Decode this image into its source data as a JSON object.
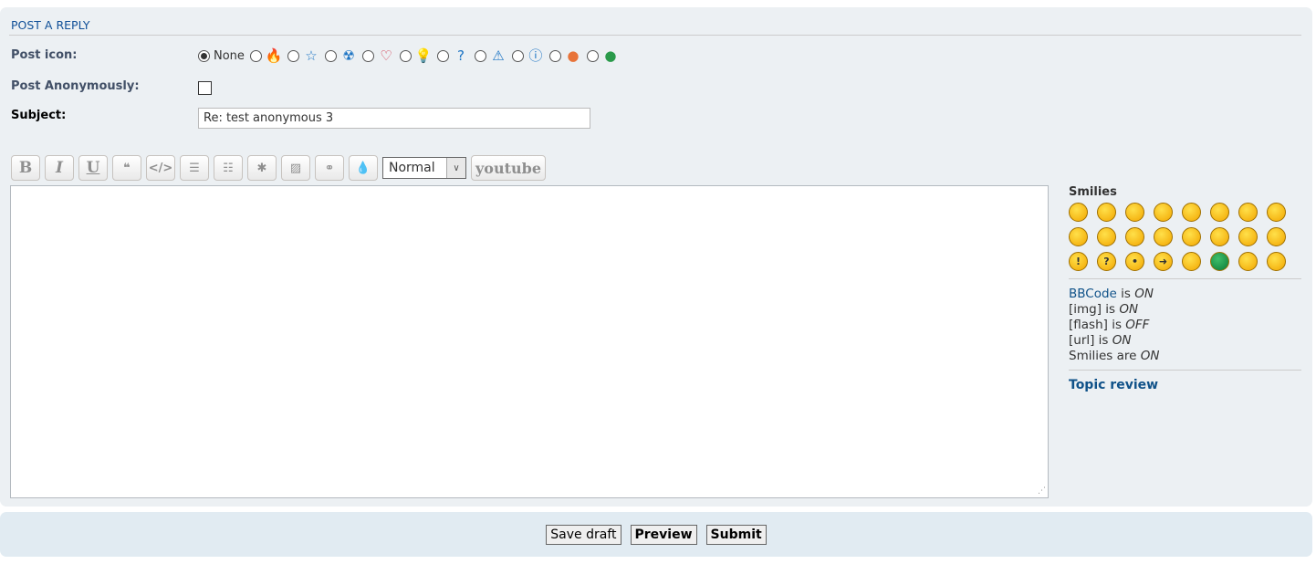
{
  "header": {
    "title": "POST A REPLY"
  },
  "form": {
    "post_icon_label": "Post icon:",
    "none_label": "None",
    "post_icons": [
      {
        "name": "fire",
        "glyph": "🔥",
        "color": "#f39a3a"
      },
      {
        "name": "star",
        "glyph": "☆",
        "color": "#1c74c4"
      },
      {
        "name": "radioactive",
        "glyph": "☢",
        "color": "#1c74c4"
      },
      {
        "name": "heart",
        "glyph": "♡",
        "color": "#d0334a"
      },
      {
        "name": "lightbulb",
        "glyph": "💡",
        "color": "#f0b020"
      },
      {
        "name": "question",
        "glyph": "?",
        "color": "#1c74c4"
      },
      {
        "name": "warning",
        "glyph": "⚠",
        "color": "#1c74c4"
      },
      {
        "name": "info",
        "glyph": "ⓘ",
        "color": "#1c74c4"
      },
      {
        "name": "smiley-orange",
        "glyph": "●",
        "color": "#e8743a"
      },
      {
        "name": "smiley-green",
        "glyph": "●",
        "color": "#2a9a4a"
      }
    ],
    "anonymous_label": "Post Anonymously:",
    "anonymous_checked": false,
    "subject_label": "Subject:",
    "subject_value": "Re: test anonymous 3",
    "message_value": ""
  },
  "toolbar": {
    "buttons": [
      {
        "name": "bold",
        "glyph": "B"
      },
      {
        "name": "italic",
        "glyph": "I"
      },
      {
        "name": "underline",
        "glyph": "U"
      },
      {
        "name": "quote",
        "glyph": "❝"
      },
      {
        "name": "code",
        "glyph": "</>"
      },
      {
        "name": "list",
        "glyph": "☰"
      },
      {
        "name": "ordered-list",
        "glyph": "☷"
      },
      {
        "name": "list-item",
        "glyph": "✱"
      },
      {
        "name": "image",
        "glyph": "▨"
      },
      {
        "name": "link",
        "glyph": "⚭"
      },
      {
        "name": "color",
        "glyph": "💧"
      }
    ],
    "font_size": "Normal",
    "youtube": "youtube"
  },
  "sidebar": {
    "smilies_title": "Smilies",
    "smilies": [
      "very-happy",
      "smile",
      "wink",
      "sad",
      "surprised",
      "shocked",
      "confused",
      "cool",
      "laughing",
      "mad",
      "razz",
      "embarrassed",
      "crying",
      "evil",
      "twisted-evil",
      "rolling-eyes",
      "exclamation",
      "question",
      "idea",
      "arrow",
      "neutral",
      "green",
      "geek",
      "uber-geek"
    ],
    "bbcode_link": "BBCode",
    "bbcode_is": " is ",
    "bbcode_state": "ON",
    "img_label": "[img] is ",
    "img_state": "ON",
    "flash_label": "[flash] is ",
    "flash_state": "OFF",
    "url_label": "[url] is ",
    "url_state": "ON",
    "smilies_label": "Smilies are ",
    "smilies_state": "ON",
    "topic_review": "Topic review"
  },
  "actions": {
    "save_draft": "Save draft",
    "preview": "Preview",
    "submit": "Submit"
  }
}
